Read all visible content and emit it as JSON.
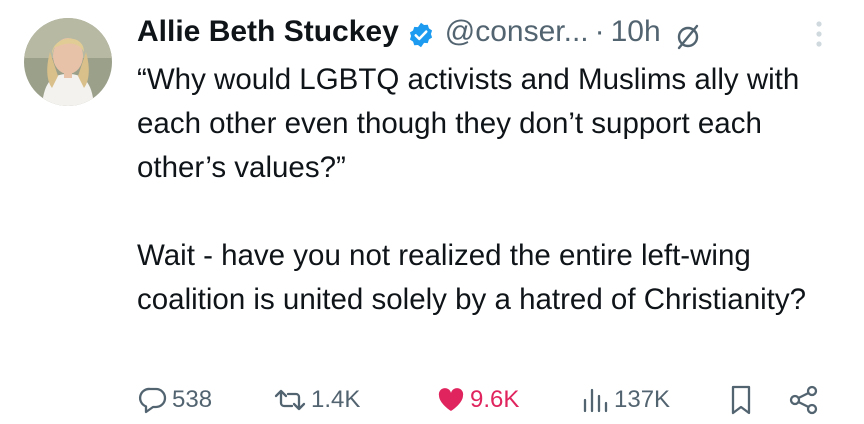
{
  "tweet": {
    "author": {
      "name": "Allie Beth Stuckey",
      "handle": "@conser...",
      "verified_icon": "verified-badge-icon",
      "verified_color": "#1d9bf0"
    },
    "separator": "·",
    "time": "10h",
    "text": {
      "paragraph1": "“Why would LGBTQ activists and Muslims ally with each other even though they don’t support each other’s values?”",
      "paragraph2": "Wait - have you not realized the entire left-wing coalition is united solely by a hatred of Christianity?"
    },
    "stats": {
      "replies": "538",
      "reposts": "1.4K",
      "likes": "9.6K",
      "views": "137K"
    },
    "colors": {
      "text": "#0f1419",
      "muted": "#536471",
      "like": "#e0245e"
    }
  }
}
